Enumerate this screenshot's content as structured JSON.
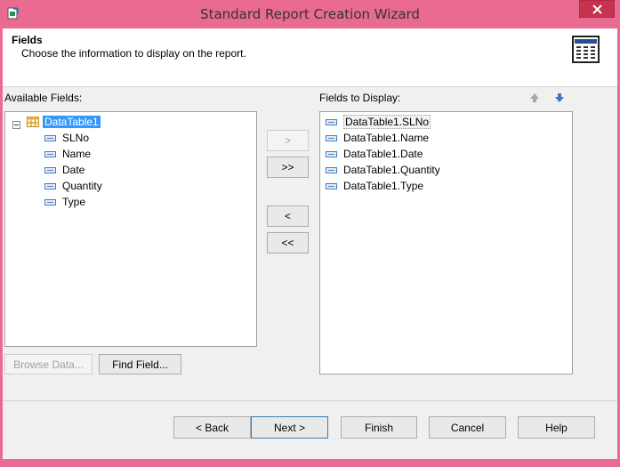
{
  "window": {
    "title": "Standard Report Creation Wizard"
  },
  "header": {
    "title": "Fields",
    "subtitle": "Choose the information to display on the report."
  },
  "available": {
    "label": "Available Fields:",
    "table": "DataTable1",
    "fields": [
      "SLNo",
      "Name",
      "Date",
      "Quantity",
      "Type"
    ]
  },
  "display": {
    "label": "Fields to Display:",
    "fields": [
      "DataTable1.SLNo",
      "DataTable1.Name",
      "DataTable1.Date",
      "DataTable1.Quantity",
      "DataTable1.Type"
    ]
  },
  "move_buttons": {
    "add": ">",
    "add_all": ">>",
    "remove": "<",
    "remove_all": "<<"
  },
  "left_buttons": {
    "browse": "Browse Data...",
    "find": "Find Field..."
  },
  "footer": {
    "back": "< Back",
    "next": "Next >",
    "finish": "Finish",
    "cancel": "Cancel",
    "help": "Help"
  },
  "colors": {
    "titlebar": "#e96b91",
    "close": "#c7324f",
    "selection": "#3399ff"
  }
}
